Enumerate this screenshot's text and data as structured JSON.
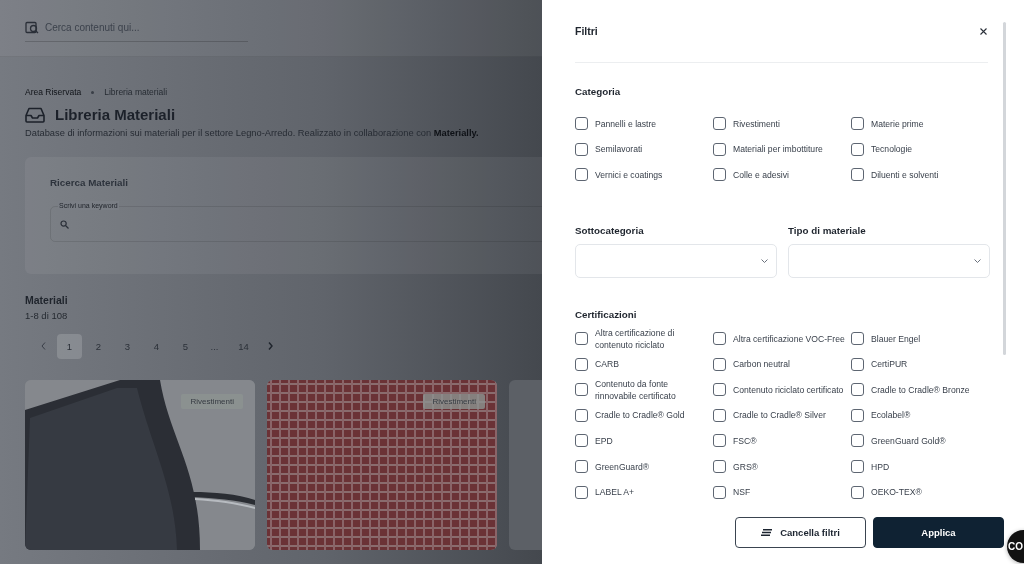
{
  "header": {
    "search_placeholder": "Cerca contenuti qui..."
  },
  "breadcrumb": [
    {
      "label": "Area Riservata"
    },
    {
      "label": "Libreria materiali"
    }
  ],
  "page": {
    "title": "Libreria Materiali",
    "description": "Database di informazioni sui materiali per il settore Legno-Arredo. Realizzato in collaborazione con **Materially.**"
  },
  "search_card": {
    "title": "Ricerca Materiali",
    "keyword_field": {
      "label": "Scrivi una keyword"
    }
  },
  "results": {
    "title": "Materiali",
    "count": "1-8 di 108"
  },
  "pagination": [
    {
      "label": "1",
      "selected": true
    },
    {
      "label": "2",
      "selected": false
    },
    {
      "label": "3",
      "selected": false
    },
    {
      "label": "4",
      "selected": false
    },
    {
      "label": "5",
      "selected": false
    },
    {
      "label": "...",
      "selected": false
    },
    {
      "label": "14",
      "selected": false
    }
  ],
  "cards": [
    {
      "kind": "picture",
      "badge": "Rivestimenti"
    },
    {
      "kind": "picture",
      "badge": "Rivestimenti"
    },
    {
      "kind": "plain"
    }
  ],
  "filters": {
    "title": "Filtri",
    "categoria": {
      "title": "Categoria",
      "options": [
        {
          "label": "Pannelli e lastre",
          "checked": false
        },
        {
          "label": "Rivestimenti",
          "checked": false
        },
        {
          "label": "Materie prime",
          "checked": false
        },
        {
          "label": "Semilavorati",
          "checked": false
        },
        {
          "label": "Materiali per imbottiture",
          "checked": false
        },
        {
          "label": "Tecnologie",
          "checked": false
        },
        {
          "label": "Vernici e coatings",
          "checked": false
        },
        {
          "label": "Colle e adesivi",
          "checked": false
        },
        {
          "label": "Diluenti e solventi",
          "checked": false
        }
      ]
    },
    "selects": [
      {
        "label": "Sottocategoria"
      },
      {
        "label": "Tipo di materiale"
      }
    ],
    "certificazioni": {
      "title": "Certificazioni",
      "options": [
        {
          "label": "Altra certificazione di contenuto riciclato",
          "checked": false
        },
        {
          "label": "Altra certificazione VOC-Free",
          "checked": false
        },
        {
          "label": "Blauer Engel",
          "checked": false
        },
        {
          "label": "CARB",
          "checked": false
        },
        {
          "label": "Carbon neutral",
          "checked": false
        },
        {
          "label": "CertiPUR",
          "checked": false
        },
        {
          "label": "Contenuto da fonte rinnovabile certificato",
          "checked": false
        },
        {
          "label": "Contenuto riciclato certificato",
          "checked": false
        },
        {
          "label": "Cradle to Cradle® Bronze",
          "checked": false
        },
        {
          "label": "Cradle to Cradle® Gold",
          "checked": false
        },
        {
          "label": "Cradle to Cradle® Silver",
          "checked": false
        },
        {
          "label": "Ecolabel®",
          "checked": false
        },
        {
          "label": "EPD",
          "checked": false
        },
        {
          "label": "FSC®",
          "checked": false
        },
        {
          "label": "GreenGuard Gold®",
          "checked": false
        },
        {
          "label": "GreenGuard®",
          "checked": false
        },
        {
          "label": "GRS®",
          "checked": false
        },
        {
          "label": "HPD",
          "checked": false
        },
        {
          "label": "LABEL A+",
          "checked": false
        },
        {
          "label": "NSF",
          "checked": false
        },
        {
          "label": "OEKO-TEX®",
          "checked": false
        }
      ]
    },
    "buttons": [
      {
        "label": "Cancella filtri",
        "kind": "secondary"
      },
      {
        "label": "Applica",
        "kind": "primary"
      }
    ]
  },
  "chat_button": {
    "label": "CO"
  }
}
